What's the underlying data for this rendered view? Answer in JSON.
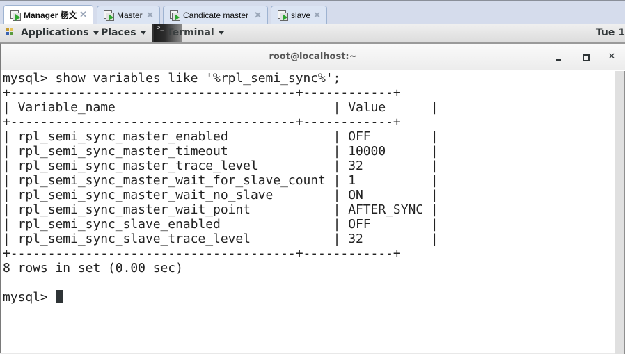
{
  "vm_tabs": [
    {
      "label": "Manager 杨文",
      "active": true,
      "close": "✕"
    },
    {
      "label": "Master",
      "active": false,
      "close": "✕"
    },
    {
      "label": "Candicate master",
      "active": false,
      "close": "✕"
    },
    {
      "label": "slave",
      "active": false,
      "close": "✕"
    }
  ],
  "panel": {
    "applications": "Applications",
    "places": "Places",
    "terminal": "Terminal",
    "terminal_thumb_prompt": ">_",
    "clock": "Tue 1"
  },
  "window": {
    "title": "root@localhost:~",
    "close_glyph": "✕"
  },
  "terminal": {
    "command_line": "mysql> show variables like '%rpl_semi_sync%';",
    "border_line": "+--------------------------------------+------------+",
    "header": {
      "name": "Variable_name",
      "value": "Value"
    },
    "rows": [
      {
        "name": "rpl_semi_sync_master_enabled",
        "value": "OFF"
      },
      {
        "name": "rpl_semi_sync_master_timeout",
        "value": "10000"
      },
      {
        "name": "rpl_semi_sync_master_trace_level",
        "value": "32"
      },
      {
        "name": "rpl_semi_sync_master_wait_for_slave_count",
        "value": "1"
      },
      {
        "name": "rpl_semi_sync_master_wait_no_slave",
        "value": "ON"
      },
      {
        "name": "rpl_semi_sync_master_wait_point",
        "value": "AFTER_SYNC"
      },
      {
        "name": "rpl_semi_sync_slave_enabled",
        "value": "OFF"
      },
      {
        "name": "rpl_semi_sync_slave_trace_level",
        "value": "32"
      }
    ],
    "summary": "8 rows in set (0.00 sec)",
    "prompt": "mysql> "
  }
}
